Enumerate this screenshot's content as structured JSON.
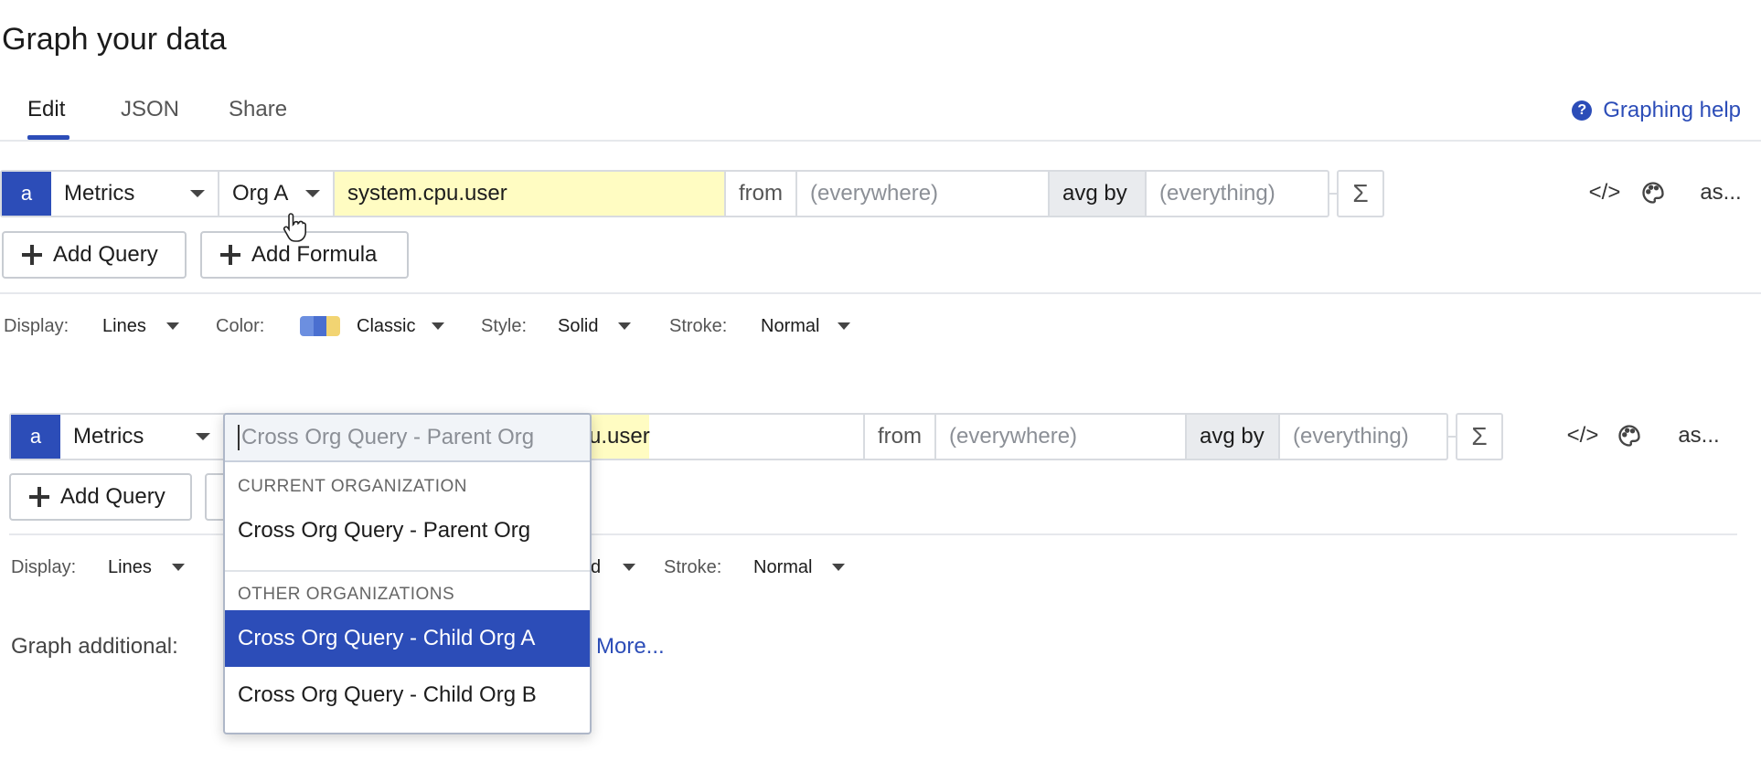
{
  "page": {
    "title": "Graph your data"
  },
  "tabs": [
    {
      "label": "Edit",
      "active": true
    },
    {
      "label": "JSON",
      "active": false
    },
    {
      "label": "Share",
      "active": false
    }
  ],
  "help": {
    "label": "Graphing help",
    "icon": "question-circle-icon",
    "color": "#2c4db8"
  },
  "query1": {
    "letter": "a",
    "source": "Metrics",
    "org": "Org A",
    "metric": "system.cpu.user",
    "from_label": "from",
    "from_placeholder": "(everywhere)",
    "avg_label": "avg by",
    "avg_placeholder": "(everything)",
    "sigma": "Σ",
    "code_icon": "</>",
    "as_label": "as..."
  },
  "query2": {
    "letter": "a",
    "source": "Metrics",
    "metric_visible": "u.user",
    "from_label": "from",
    "from_placeholder": "(everywhere)",
    "avg_label": "avg by",
    "avg_placeholder": "(everything)",
    "sigma": "Σ",
    "code_icon": "</>",
    "as_label": "as..."
  },
  "buttons": {
    "add_query": "Add Query",
    "add_formula": "Add Formula"
  },
  "options1": {
    "display_label": "Display:",
    "display_value": "Lines",
    "color_label": "Color:",
    "color_value": "Classic",
    "style_label": "Style:",
    "style_value": "Solid",
    "stroke_label": "Stroke:",
    "stroke_value": "Normal"
  },
  "options2": {
    "display_label": "Display:",
    "display_value": "Lines",
    "style_value_partial": "d",
    "stroke_label": "Stroke:",
    "stroke_value": "Normal"
  },
  "graph_additional": {
    "label": "Graph additional:",
    "more_link": "More..."
  },
  "dropdown": {
    "search_placeholder": "Cross Org Query - Parent Org",
    "current_section": "CURRENT ORGANIZATION",
    "current_items": [
      "Cross Org Query - Parent Org"
    ],
    "other_section": "OTHER ORGANIZATIONS",
    "other_items": [
      "Cross Org Query - Child Org A",
      "Cross Org Query - Child Org B"
    ],
    "selected": "Cross Org Query - Child Org A"
  },
  "colors": {
    "accent": "#2c4db8",
    "metric_highlight": "#fffcc2",
    "palette": [
      "#6c8fe0",
      "#4a6fd0",
      "#f2d472"
    ]
  }
}
